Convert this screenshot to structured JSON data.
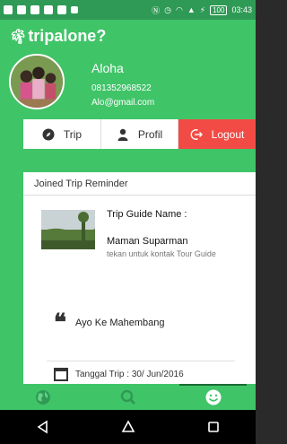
{
  "status_bar": {
    "battery": "100",
    "time": "03:43"
  },
  "app": {
    "logo_text": "tripalone?"
  },
  "profile": {
    "name": "Aloha",
    "phone": "081352968522",
    "email": "Alo@gmail.com"
  },
  "tabs": [
    {
      "label": "Trip",
      "icon": "compass-icon"
    },
    {
      "label": "Profil",
      "icon": "person-icon"
    },
    {
      "label": "Logout",
      "icon": "logout-icon"
    }
  ],
  "reminder": {
    "header": "Joined Trip Reminder",
    "guide_title": "Trip Guide Name :",
    "guide_name": "Maman Suparman",
    "guide_hint": "tekan untuk kontak Tour Guide",
    "trip_name": "Ayo Ke Mahembang",
    "trip_date": "Tanggal Trip : 30/ Jun/2016"
  },
  "bottom_nav": [
    {
      "icon": "globe-icon"
    },
    {
      "icon": "search-icon"
    },
    {
      "icon": "smiley-icon",
      "active": true
    }
  ],
  "colors": {
    "primary": "#40c468",
    "status_bar": "#2f9a55",
    "logout": "#f24b45"
  }
}
